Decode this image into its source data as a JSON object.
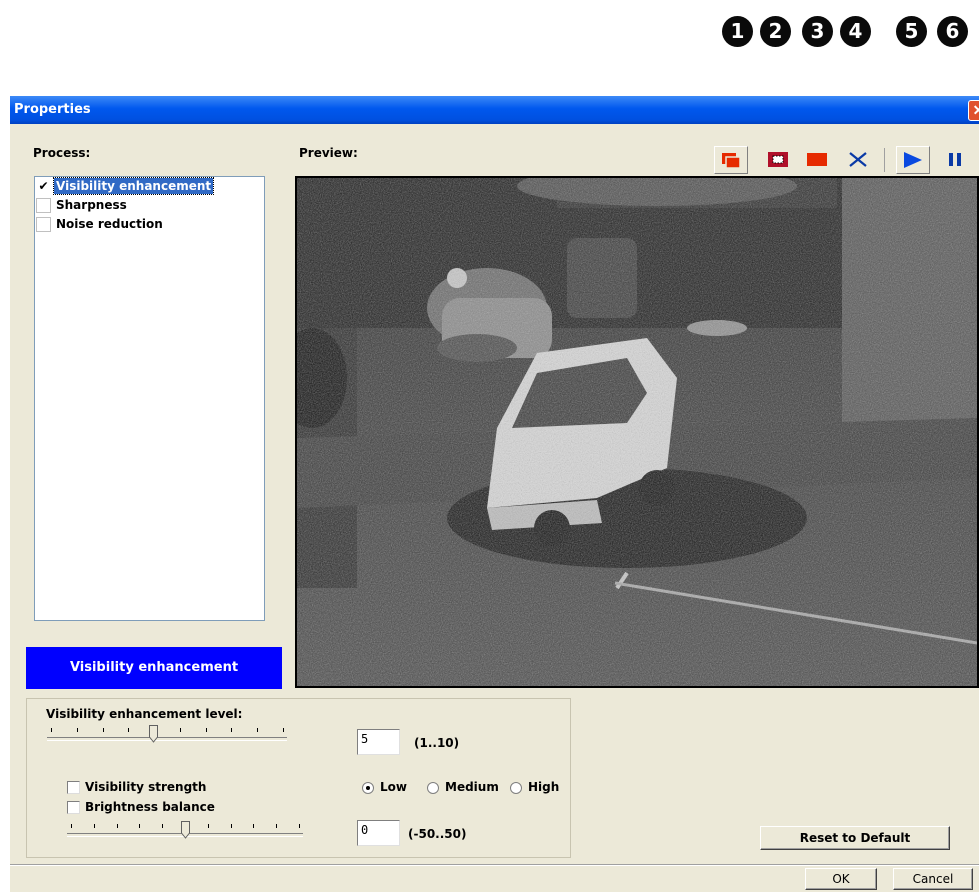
{
  "callouts": [
    "1",
    "2",
    "3",
    "4",
    "5",
    "6"
  ],
  "dialog": {
    "title": "Properties",
    "close_glyph": "✕"
  },
  "process": {
    "label": "Process:",
    "items": [
      {
        "label": "Visibility enhancement",
        "checked": true,
        "selected": true
      },
      {
        "label": "Sharpness",
        "checked": false,
        "selected": false
      },
      {
        "label": "Noise reduction",
        "checked": false,
        "selected": false
      }
    ],
    "selected_title": "Visibility enhancement"
  },
  "preview": {
    "label": "Preview:",
    "toolbar": [
      "split-view-icon",
      "selection-view-icon",
      "full-view-icon",
      "close-view-icon",
      "play-icon",
      "pause-icon"
    ]
  },
  "settings": {
    "level_label": "Visibility enhancement level:",
    "level_value": "5",
    "level_range": "(1..10)",
    "level_fraction": 0.44,
    "strength_label": "Visibility strength",
    "strength_options": [
      "Low",
      "Medium",
      "High"
    ],
    "strength_selected": "Low",
    "brightness_label": "Brightness balance",
    "brightness_value": "0",
    "brightness_range": "(-50..50)",
    "brightness_fraction": 0.5
  },
  "buttons": {
    "reset": "Reset to Default",
    "ok": "OK",
    "cancel": "Cancel"
  },
  "colors": {
    "dialog_bg": "#ece9d8",
    "selection_bar": "#0000ff",
    "toolbar_red": "#e62a00",
    "toolbar_blue": "#0a3aa6"
  }
}
